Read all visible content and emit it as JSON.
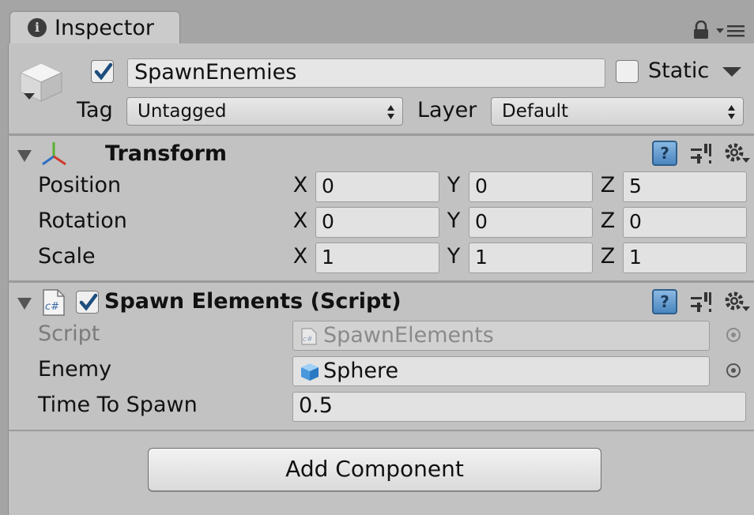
{
  "tab": {
    "title": "Inspector",
    "info_icon": "i"
  },
  "header": {
    "active": true,
    "name": "SpawnEnemies",
    "static_label": "Static",
    "static_checked": false,
    "tag_label": "Tag",
    "tag_value": "Untagged",
    "layer_label": "Layer",
    "layer_value": "Default"
  },
  "transform": {
    "title": "Transform",
    "position": {
      "label": "Position",
      "x": "0",
      "y": "0",
      "z": "5"
    },
    "rotation": {
      "label": "Rotation",
      "x": "0",
      "y": "0",
      "z": "0"
    },
    "scale": {
      "label": "Scale",
      "x": "1",
      "y": "1",
      "z": "1"
    },
    "axis_x": "X",
    "axis_y": "Y",
    "axis_z": "Z"
  },
  "script_component": {
    "title": "Spawn Elements (Script)",
    "enabled": true,
    "script_label": "Script",
    "script_value": "SpawnElements",
    "enemy_label": "Enemy",
    "enemy_value": "Sphere",
    "time_label": "Time To Spawn",
    "time_value": "0.5",
    "cs_badge": "c#"
  },
  "help_badge": "?",
  "add_component_label": "Add Component",
  "icons": [
    "info-icon",
    "lock-icon",
    "menu-icon",
    "gameobject-icon",
    "transform-axes-icon",
    "script-file-icon",
    "help-icon",
    "preset-icon",
    "gear-icon",
    "object-picker-icon",
    "sphere-mesh-icon"
  ],
  "colors": {
    "panel_bg": "#c2c2c2",
    "window_bg": "#a5a5a5",
    "field_bg": "#e2e2e2",
    "help_blue": "#4a86bf"
  }
}
